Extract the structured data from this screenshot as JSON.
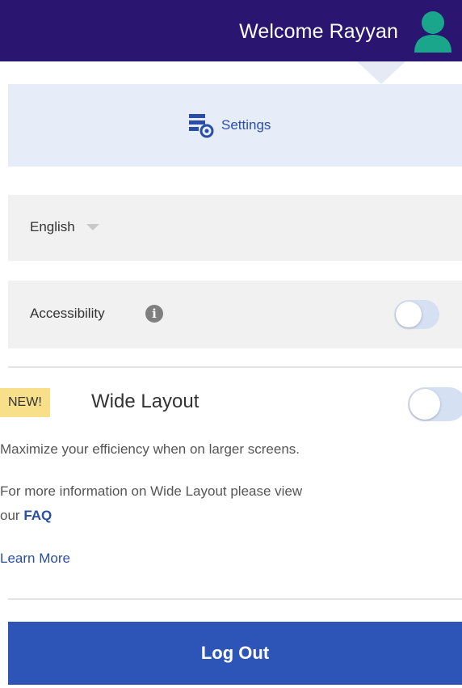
{
  "header": {
    "welcome_text": "Welcome Rayyan",
    "avatar_icon": "user-avatar-icon",
    "accent_color": "#2a1570",
    "avatar_color": "#1aa68a"
  },
  "settings": {
    "label": "Settings",
    "icon": "settings-gear-icon"
  },
  "language": {
    "selected": "English"
  },
  "accessibility": {
    "label": "Accessibility",
    "info_icon": "info-icon",
    "enabled": false
  },
  "wide_layout": {
    "badge": "NEW!",
    "title": "Wide Layout",
    "enabled": false,
    "description": "Maximize your efficiency when on larger screens.",
    "info_prefix_line1": "For more information on Wide Layout please view",
    "info_prefix_line2": "our",
    "faq_link": "FAQ",
    "learn_more": "Learn More"
  },
  "logout": {
    "label": "Log Out",
    "color": "#2d55b8"
  }
}
